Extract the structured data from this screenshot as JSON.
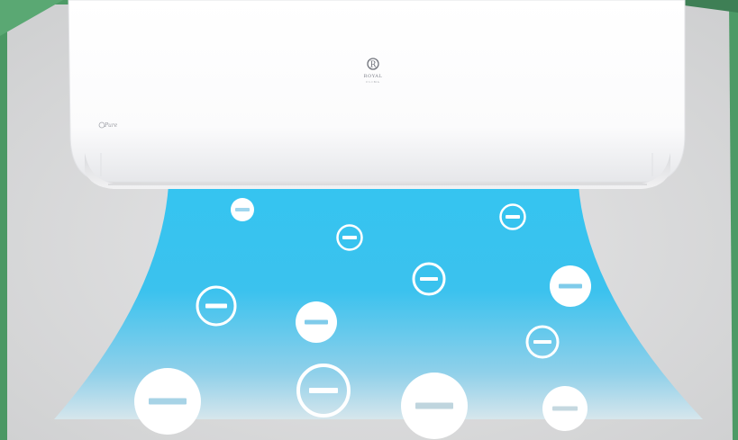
{
  "brand": {
    "name": "ROYAL",
    "subline": "CLIMA",
    "logo_letter": "R"
  },
  "unit": {
    "model_label": "Pure"
  },
  "ion_icon": "minus-circle-icon",
  "colors": {
    "airflow_top": "#35c4f0",
    "airflow_mid": "#38c1ef",
    "airflow_bottom": "#cfe4ec",
    "background": "#dcdcdd",
    "frame_green": "#4d9a66",
    "ion_fill": "#ffffff",
    "ion_dash": "#9fd6ee"
  }
}
